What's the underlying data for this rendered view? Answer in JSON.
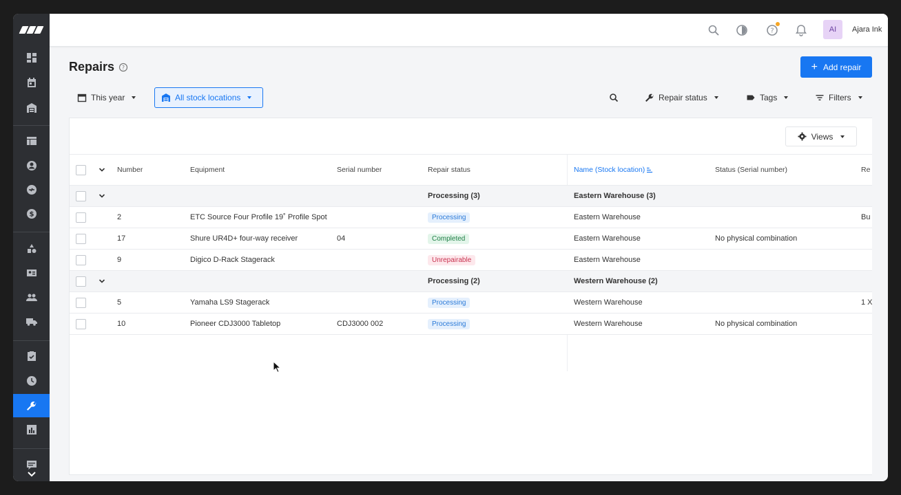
{
  "app": {
    "user_initials": "AI",
    "user_name": "Ajara Ink"
  },
  "page": {
    "title": "Repairs",
    "add_button": "Add repair"
  },
  "filters": {
    "period": "This year",
    "location": "All stock locations",
    "repair_status": "Repair status",
    "tags": "Tags",
    "filters": "Filters"
  },
  "views": "Views",
  "columns": {
    "number": "Number",
    "equipment": "Equipment",
    "serial": "Serial number",
    "repair_status": "Repair status",
    "location": "Name (Stock location)",
    "serial_status": "Status (Serial number)",
    "last": "Re"
  },
  "groups": [
    {
      "status": "Processing (3)",
      "location": "Eastern Warehouse (3)",
      "rows": [
        {
          "number": "2",
          "equipment": "ETC Source Four Profile 19˚ Profile Spot",
          "serial": "",
          "status": "Processing",
          "status_kind": "processing",
          "location": "Eastern Warehouse",
          "serial_status": "",
          "extra": "Bu"
        },
        {
          "number": "17",
          "equipment": "Shure UR4D+ four-way receiver",
          "serial": "04",
          "status": "Completed",
          "status_kind": "completed",
          "location": "Eastern Warehouse",
          "serial_status": "No physical combination",
          "extra": ""
        },
        {
          "number": "9",
          "equipment": "Digico D-Rack Stagerack",
          "serial": "",
          "status": "Unrepairable",
          "status_kind": "unrepairable",
          "location": "Eastern Warehouse",
          "serial_status": "",
          "extra": ""
        }
      ]
    },
    {
      "status": "Processing (2)",
      "location": "Western Warehouse (2)",
      "rows": [
        {
          "number": "5",
          "equipment": "Yamaha LS9 Stagerack",
          "serial": "",
          "status": "Processing",
          "status_kind": "processing",
          "location": "Western Warehouse",
          "serial_status": "",
          "extra": "1 X"
        },
        {
          "number": "10",
          "equipment": "Pioneer CDJ3000 Tabletop",
          "serial": "CDJ3000 002",
          "status": "Processing",
          "status_kind": "processing",
          "location": "Western Warehouse",
          "serial_status": "No physical combination",
          "extra": ""
        }
      ]
    }
  ],
  "colors": {
    "accent": "#1877f2",
    "sidebar": "#2d2f33"
  }
}
